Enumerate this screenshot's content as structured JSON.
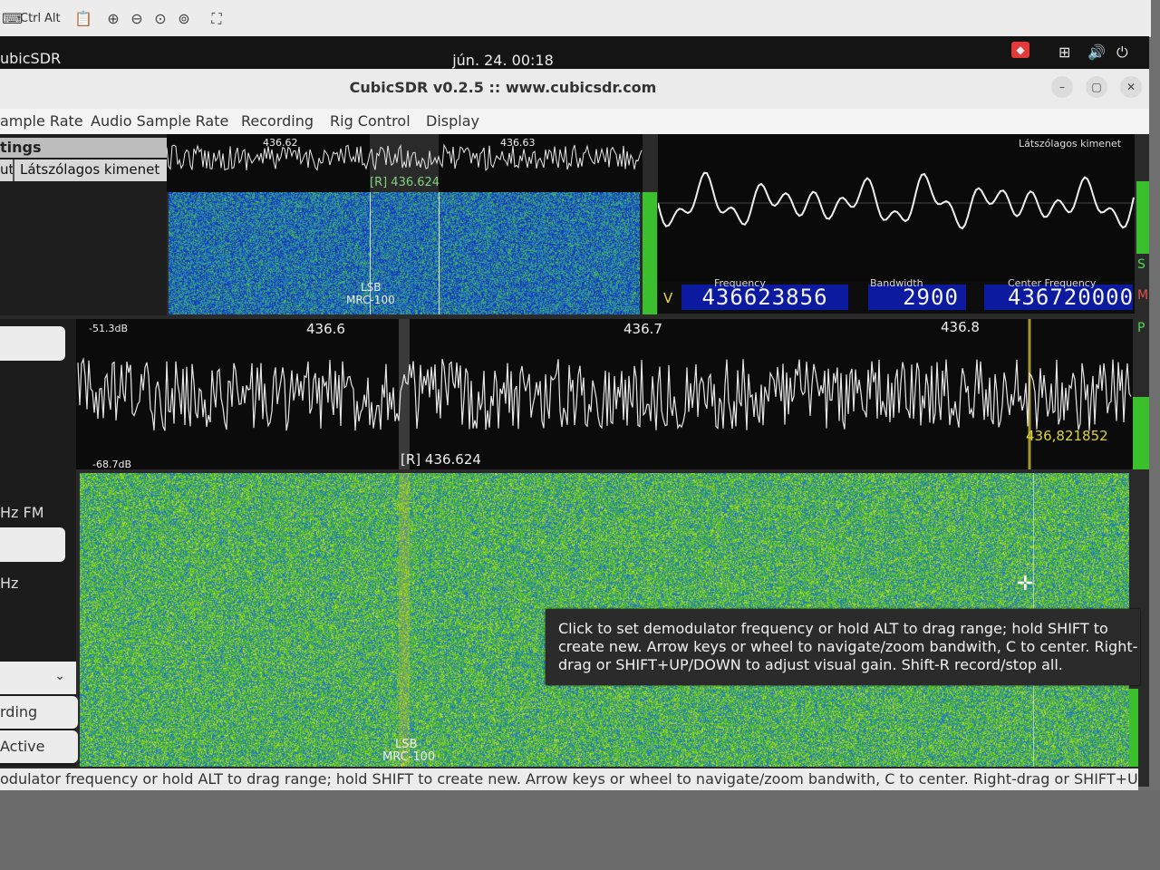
{
  "toolbar": {
    "ctrl_label": "Ctrl",
    "alt_label": "Alt"
  },
  "system": {
    "app_name": "ubicSDR",
    "clock": "jún. 24.  00:18"
  },
  "window": {
    "title": "CubicSDR v0.2.5 :: www.cubicsdr.com"
  },
  "menu": {
    "items": [
      "ample Rate",
      "Audio Sample Rate",
      "Recording",
      "Rig Control",
      "Display"
    ]
  },
  "left_panel": {
    "header": "tings",
    "row_prefix": "ut",
    "row_output": "Látszólagos kimenet"
  },
  "small_spectrum": {
    "tick_1": "436.62",
    "tick_2": "436.63",
    "marker": "[R]  436.624",
    "wf_mode": "LSB",
    "wf_label": "MRC-100"
  },
  "scope": {
    "label": "Látszólagos kimenet",
    "side_s": "S",
    "side_m": "M",
    "side_v": "V",
    "side_p": "P"
  },
  "freq": {
    "frequency_label": "Frequency",
    "frequency_value": "436623856",
    "bandwidth_label": "Bandwidth",
    "bandwidth_value": "2900",
    "center_label": "Center  Frequency",
    "center_value": "436720000"
  },
  "main_spectrum": {
    "db_top": "-51.3dB",
    "db_bottom": "-68.7dB",
    "tick_1": "436.6",
    "tick_2": "436.7",
    "tick_3": "436.8",
    "marker": "[R]  436.624",
    "cursor_freq": "436,821852",
    "wf_mode": "LSB",
    "wf_label": "MRC-100"
  },
  "left_lower": {
    "mode_text": "Hz FM",
    "unit_text": "Hz",
    "recording_btn": "rding",
    "active_btn": "Active"
  },
  "tooltip": {
    "text": "Click to set demodulator frequency or hold ALT to drag range; hold SHIFT to create new. Arrow keys or wheel to navigate/zoom bandwith, C to center. Right-drag or SHIFT+UP/DOWN to adjust visual gain. Shift-R record/stop all."
  },
  "status": {
    "text": "odulator frequency or hold ALT to drag range; hold SHIFT to create new. Arrow keys or wheel to navigate/zoom bandwith, C to center. Right-drag or SHIFT+UP/DOWN ..."
  },
  "colors": {
    "freq_display_bg": "#0c1aa0",
    "meter_green": "#3cbf2c",
    "cursor_yellow": "#e0d23a"
  }
}
